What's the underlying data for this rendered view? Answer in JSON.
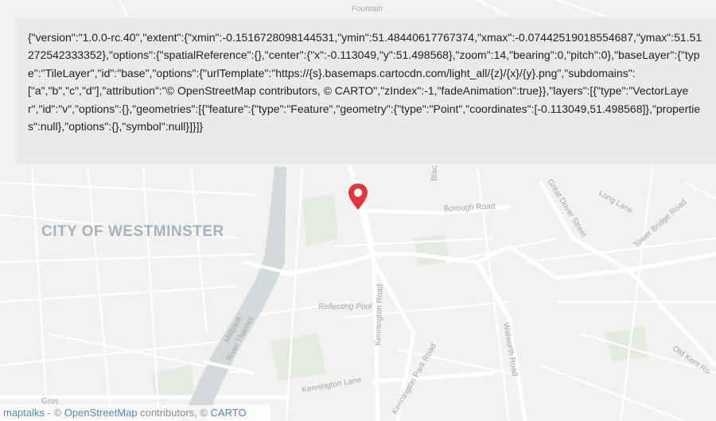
{
  "map": {
    "district_label": "CITY OF WESTMINSTER",
    "river_label": "River Thames",
    "street_labels": {
      "borough_road": "Borough Road",
      "great_dover_street": "Great Dover Street",
      "long_lane": "Long Lane",
      "tower_bridge_road": "Tower Bridge Road",
      "kennington_road": "Kennington Road",
      "kennington_park_road": "Kennington Park Road",
      "walworth_road": "Walworth Road",
      "kennington_lane": "Kennington Lane",
      "old_kent_road": "Old Kent Ro",
      "millbank": "Millbank",
      "reflecting_pool": "Reflecting Pool",
      "fountain": "Fountain",
      "blac": "Blac",
      "gros": "Gros"
    },
    "colors": {
      "land": "#f2f2f0",
      "roads": "#ffffff",
      "water": "#d4dadc",
      "parks": "#e6ebe2",
      "marker": "#e8333a"
    },
    "marker_icon": "map-pin-icon"
  },
  "json_panel": {
    "text": "{\"version\":\"1.0.0-rc.40\",\"extent\":{\"xmin\":-0.1516728098144531,\"ymin\":51.48440617767374,\"xmax\":-0.07442519018554687,\"ymax\":51.51272542333352},\"options\":{\"spatialReference\":{},\"center\":{\"x\":-0.113049,\"y\":51.498568},\"zoom\":14,\"bearing\":0,\"pitch\":0},\"baseLayer\":{\"type\":\"TileLayer\",\"id\":\"base\",\"options\":{\"urlTemplate\":\"https://{s}.basemaps.cartocdn.com/light_all/{z}/{x}/{y}.png\",\"subdomains\":[\"a\",\"b\",\"c\",\"d\"],\"attribution\":\"© OpenStreetMap contributors, © CARTO\",\"zIndex\":-1,\"fadeAnimation\":true}},\"layers\":[{\"type\":\"VectorLayer\",\"id\":\"v\",\"options\":{},\"geometries\":[{\"feature\":{\"type\":\"Feature\",\"geometry\":{\"type\":\"Point\",\"coordinates\":[-0.113049,51.498568]},\"properties\":null},\"options\":{},\"symbol\":null}]}]}"
  },
  "attribution": {
    "maptalks": "maptalks",
    "separator": " - © ",
    "osm": "OpenStreetMap",
    "contributors": " contributors, © ",
    "carto": "CARTO"
  }
}
